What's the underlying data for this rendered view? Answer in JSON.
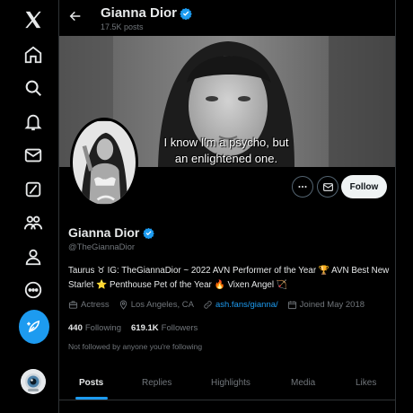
{
  "header": {
    "name": "Gianna Dior",
    "posts_count": "17.5K posts"
  },
  "banner": {
    "caption_line1": "I know I'm a psycho, but",
    "caption_line2": "an enlightened one."
  },
  "profile": {
    "name": "Gianna Dior",
    "handle": "@TheGiannaDior",
    "bio": "Taurus ♉ IG: TheGiannaDior ~ 2022 AVN Performer of the Year 🏆 AVN Best New Starlet ⭐ Penthouse Pet of the Year 🔥 Vixen Angel 🏹",
    "occupation": "Actress",
    "location": "Los Angeles, CA",
    "link": "ash.fans/gianna/",
    "joined": "Joined May 2018",
    "following_count": "440",
    "following_label": "Following",
    "followers_count": "619.1K",
    "followers_label": "Followers",
    "not_followed_text": "Not followed by anyone you're following"
  },
  "actions": {
    "follow_label": "Follow"
  },
  "tabs": [
    {
      "label": "Posts"
    },
    {
      "label": "Replies"
    },
    {
      "label": "Highlights"
    },
    {
      "label": "Media"
    },
    {
      "label": "Likes"
    }
  ],
  "colors": {
    "accent": "#1d9bf0",
    "background": "#000000",
    "muted_text": "#71767b"
  },
  "icons": {
    "nav": [
      "x-logo-icon",
      "home-icon",
      "search-icon",
      "notifications-icon",
      "messages-icon",
      "grok-icon",
      "communities-icon",
      "profile-icon",
      "more-icon",
      "post-icon"
    ],
    "profile_meta": [
      "briefcase-icon",
      "location-pin-icon",
      "link-icon",
      "calendar-icon"
    ]
  }
}
